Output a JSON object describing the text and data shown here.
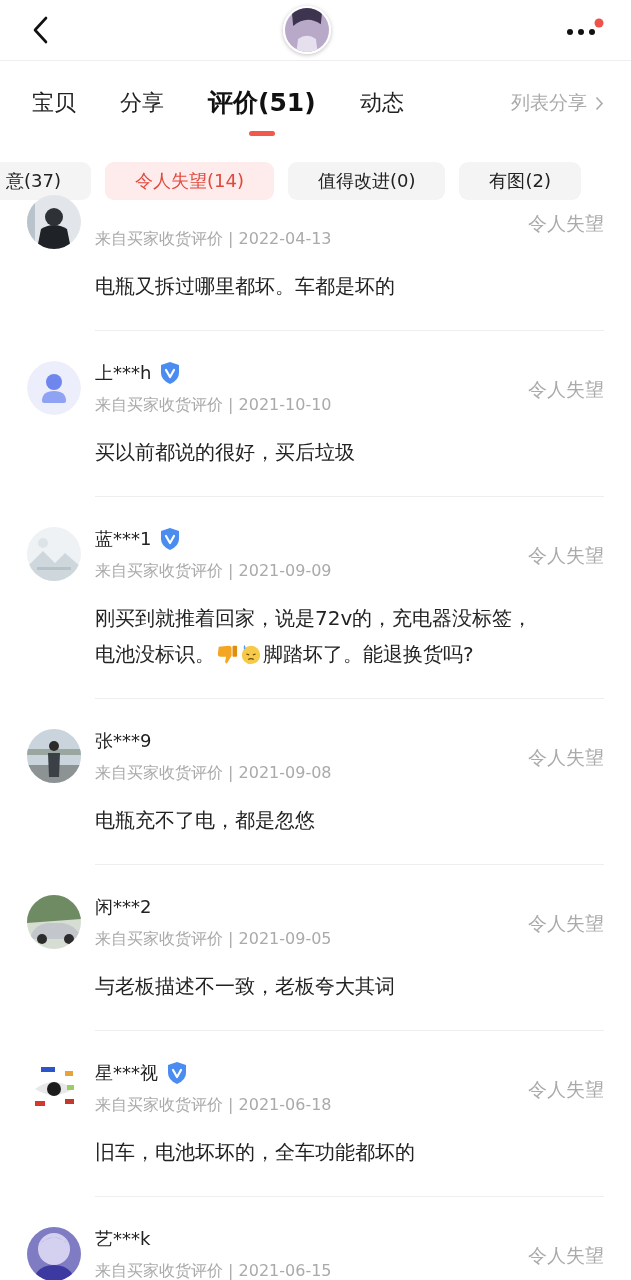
{
  "tabs": [
    {
      "label": "宝贝",
      "selected": false
    },
    {
      "label": "分享",
      "selected": false
    },
    {
      "label": "评价(51)",
      "selected": true
    },
    {
      "label": "动态",
      "selected": false
    }
  ],
  "share_link": {
    "label": "列表分享"
  },
  "filters": [
    {
      "label": "意(37)",
      "selected": false
    },
    {
      "label": "令人失望(14)",
      "selected": true
    },
    {
      "label": "值得改进(0)",
      "selected": false
    },
    {
      "label": "有图(2)",
      "selected": false
    }
  ],
  "reviews": [
    {
      "verified": false,
      "meta": "来自买家收货评价 | 2022-04-13",
      "rating": "令人失望",
      "segments": [
        {
          "kind": "text",
          "text": "电瓶又拆过哪里都坏。车都是坏的"
        }
      ]
    },
    {
      "avatar": {
        "kind": "default"
      },
      "name": "上***h",
      "verified": true,
      "meta": "来自买家收货评价 | 2021-10-10",
      "rating": "令人失望",
      "segments": [
        {
          "kind": "text",
          "text": "买以前都说的很好，买后垃圾"
        }
      ]
    },
    {
      "name": "蓝***1",
      "verified": true,
      "meta": "来自买家收货评价 | 2021-09-09",
      "rating": "令人失望",
      "segments": [
        {
          "kind": "text",
          "text": "刚买到就推着回家，说是72v的，充电器没标签，"
        },
        {
          "kind": "text",
          "text": "电池没标识。"
        },
        {
          "kind": "thumbs_down"
        },
        {
          "kind": "sweat_face"
        },
        {
          "kind": "text",
          "text": "脚踏坏了。能退换货吗?"
        }
      ]
    },
    {
      "name": "张***9",
      "verified": false,
      "meta": "来自买家收货评价 | 2021-09-08",
      "rating": "令人失望",
      "segments": [
        {
          "kind": "text",
          "text": "电瓶充不了电，都是忽悠"
        }
      ]
    },
    {
      "name": "闲***2",
      "verified": false,
      "meta": "来自买家收货评价 | 2021-09-05",
      "rating": "令人失望",
      "segments": [
        {
          "kind": "text",
          "text": "与老板描述不一致，老板夸大其词"
        }
      ]
    },
    {
      "name": "星***视",
      "verified": true,
      "meta": "来自买家收货评价 | 2021-06-18",
      "rating": "令人失望",
      "segments": [
        {
          "kind": "text",
          "text": "旧车，电池坏坏的，全车功能都坏的"
        }
      ]
    },
    {
      "name": "艺***k",
      "verified": false,
      "meta": "来自买家收货评价 | 2021-06-15",
      "rating": "令人失望"
    }
  ]
}
